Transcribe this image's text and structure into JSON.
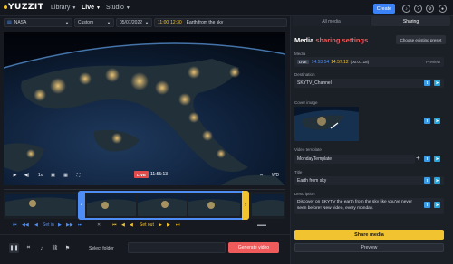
{
  "app": {
    "logo": "YUZZIT"
  },
  "nav": {
    "library": "Library",
    "live": "Live",
    "studio": "Studio"
  },
  "topbar": {
    "create_label": "Create",
    "icons": [
      "bell-icon",
      "help-icon",
      "gear-icon",
      "user-icon"
    ]
  },
  "filters": {
    "source": "NASA",
    "range": "Custom",
    "date": "05/07/2022",
    "time_start": "11:00",
    "time_end": "12:30",
    "clip_title": "Earth from the sky"
  },
  "player": {
    "live_label": "LIVE",
    "live_time": "11:55:13",
    "speed": "1x",
    "quality": "WD",
    "progress": 0.48
  },
  "timeline": {
    "set_in": "Set in",
    "set_out": "Set out"
  },
  "bottom": {
    "select_folder": "Select folder",
    "search_placeholder": "",
    "generate": "Generate video"
  },
  "panel": {
    "tabs": [
      "All media",
      "Sharing"
    ],
    "active_tab": "Sharing",
    "title_prefix": "Media ",
    "title_accent": "sharing settings",
    "preset_label": "Choose existing preset",
    "media_label": "Media",
    "media_badge": "LIVE",
    "media_in": "14:53:54",
    "media_out": "14:57:12",
    "media_duration": "(00:01:18)",
    "media_preview": "Preview",
    "destination_label": "Destination",
    "destination_value": "SKYTV_Channel",
    "cover_label": "Cover image",
    "template_label": "Video template",
    "template_value": "MondayTemplate",
    "title_label": "Title",
    "title_value": "Earth from sky",
    "description_label": "Description",
    "description_value": "Discover on SKYTV the earth from the sky like you've never seen before! New video, every monday.",
    "share_label": "Share media",
    "preview_label": "Preview"
  },
  "colors": {
    "accent_red": "#ef5a5a",
    "accent_yellow": "#f2c330",
    "accent_blue": "#4d8df5",
    "bg": "#16191f"
  }
}
